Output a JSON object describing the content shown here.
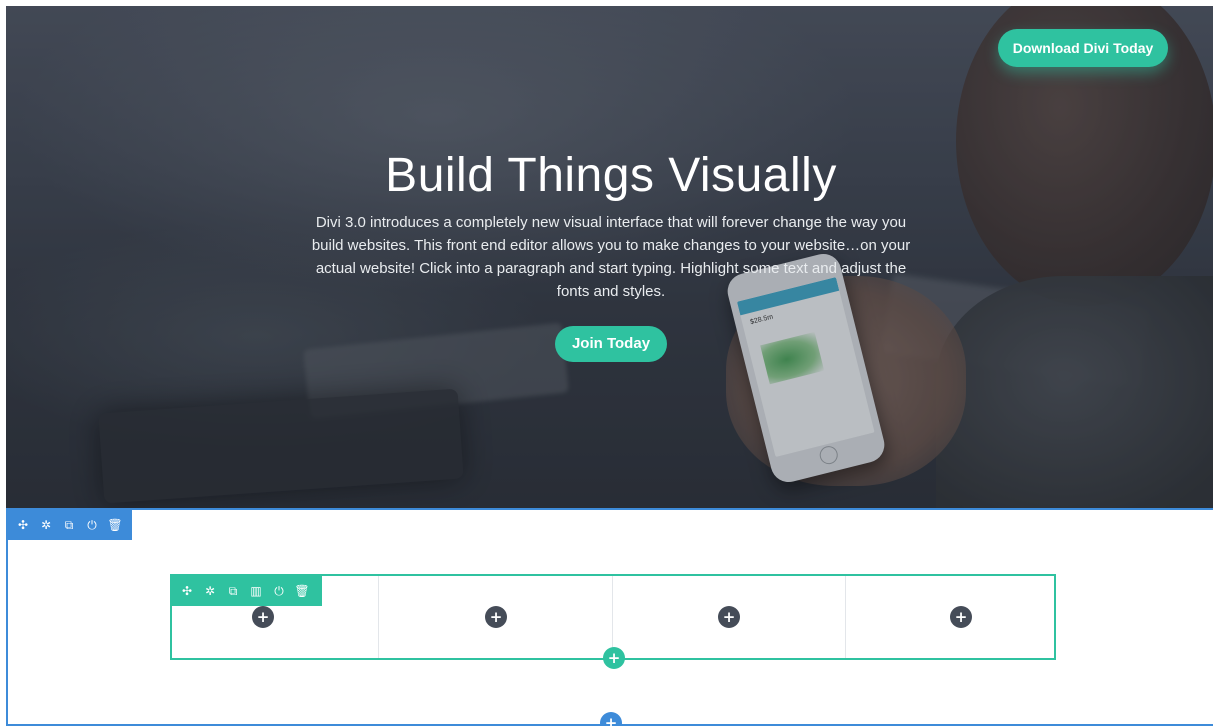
{
  "hero": {
    "download_button": "Download Divi Today",
    "title": "Build Things Visually",
    "description": "Divi 3.0 introduces a completely new visual interface that will forever change the way you build websites. This front end editor allows you to make changes to your website…on your actual website! Click into a paragraph and start typing. Highlight some text and adjust the fonts and styles.",
    "join_button": "Join Today",
    "phone_value": "$28.5m"
  },
  "section_toolbar": {
    "icons": [
      "move-icon",
      "settings-icon",
      "duplicate-icon",
      "power-icon",
      "trash-icon"
    ],
    "glyphs": [
      "✣",
      "✲",
      "⧉",
      "⏻",
      "🗑"
    ]
  },
  "row_toolbar": {
    "icons": [
      "move-icon",
      "settings-icon",
      "duplicate-icon",
      "columns-icon",
      "power-icon",
      "trash-icon"
    ],
    "glyphs": [
      "✣",
      "✲",
      "⧉",
      "▥",
      "⏻",
      "🗑"
    ]
  },
  "columns": [
    {
      "add_glyph": "+"
    },
    {
      "add_glyph": "+"
    },
    {
      "add_glyph": "+"
    },
    {
      "add_glyph": "+"
    }
  ],
  "row_add_glyph": "+",
  "section_add_glyph": "+",
  "colors": {
    "accent_green": "#2fc2a0",
    "section_blue": "#3d8bd9",
    "column_add": "#454c58"
  }
}
